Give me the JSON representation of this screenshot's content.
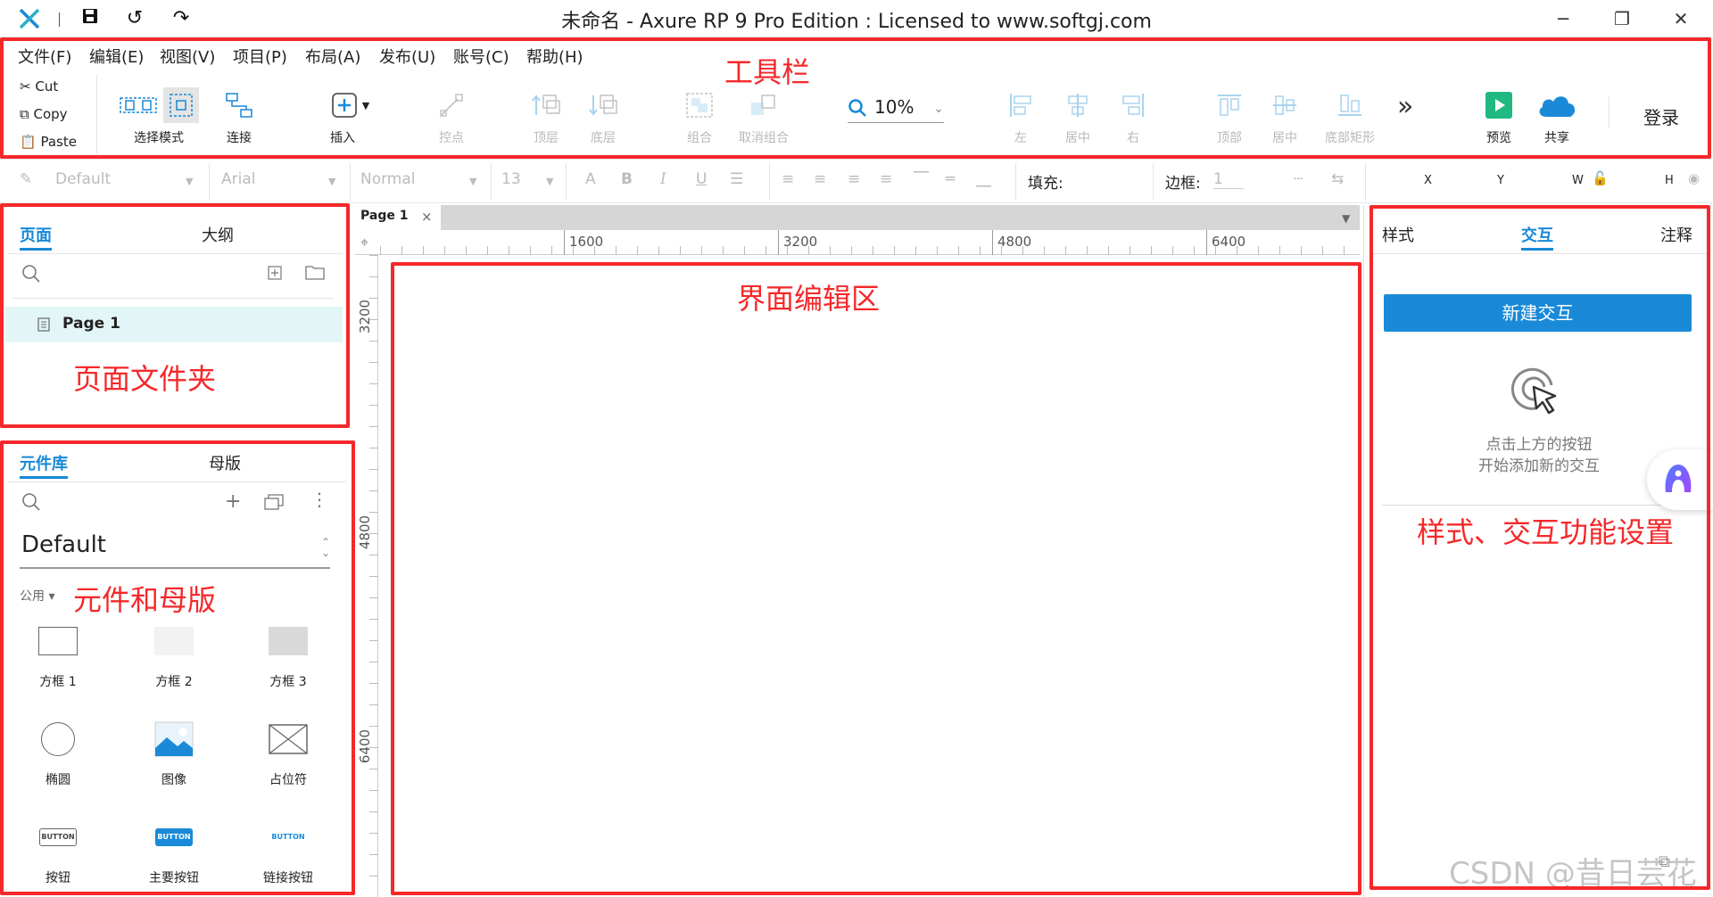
{
  "window": {
    "title": "未命名 - Axure RP 9 Pro Edition : Licensed to www.softgj.com",
    "logo_text": "X"
  },
  "menu": [
    "文件(F)",
    "编辑(E)",
    "视图(V)",
    "项目(P)",
    "布局(A)",
    "发布(U)",
    "账号(C)",
    "帮助(H)"
  ],
  "clipboard": {
    "cut": "Cut",
    "copy": "Copy",
    "paste": "Paste"
  },
  "toolbar": {
    "select_mode": "选择模式",
    "connect": "连接",
    "insert": "插入",
    "anchor": "控点",
    "top_layer": "顶层",
    "bottom_layer": "底层",
    "group": "组合",
    "ungroup": "取消组合",
    "zoom": "10%",
    "align_left": "左",
    "align_center": "居中",
    "align_right": "右",
    "align_top": "顶部",
    "align_middle": "居中",
    "align_bottom": "底部矩形",
    "more": "»",
    "preview": "预览",
    "share": "共享",
    "login": "登录"
  },
  "format": {
    "style": "Default",
    "font": "Arial",
    "weight": "Normal",
    "size": "13",
    "fill_label": "填充:",
    "border_label": "边框:",
    "border_value": "1",
    "x_label": "X",
    "y_label": "Y",
    "w_label": "W",
    "h_label": "H"
  },
  "pages_panel": {
    "tab_pages": "页面",
    "tab_outline": "大纲",
    "page_item": "Page 1"
  },
  "library_panel": {
    "tab_library": "元件库",
    "tab_masters": "母版",
    "library_name": "Default",
    "group_label": "公用 ▾",
    "widgets": [
      "方框 1",
      "方框 2",
      "方框 3",
      "椭圆",
      "图像",
      "占位符",
      "按钮",
      "主要按钮",
      "链接按钮"
    ],
    "button_text": "BUTTON"
  },
  "canvas": {
    "tab": "Page 1",
    "tab_close": "×",
    "ruler_h": [
      "1600",
      "3200",
      "4800",
      "6400"
    ],
    "ruler_v": [
      "3200",
      "4800",
      "6400"
    ]
  },
  "right_panel": {
    "tab_style": "样式",
    "tab_interaction": "交互",
    "tab_notes": "注释",
    "new_interaction": "新建交互",
    "hint_line1": "点击上方的按钮",
    "hint_line2": "开始添加新的交互"
  },
  "annotations": {
    "toolbar": "工具栏",
    "page_folder": "页面文件夹",
    "widgets_masters": "元件和母版",
    "editor_area": "界面编辑区",
    "style_interaction": "样式、交互功能设置"
  },
  "watermark": "CSDN @昔日芸花",
  "colors": {
    "accent": "#1789d6",
    "annotation": "#f5282a",
    "preview_green": "#1fb981"
  }
}
